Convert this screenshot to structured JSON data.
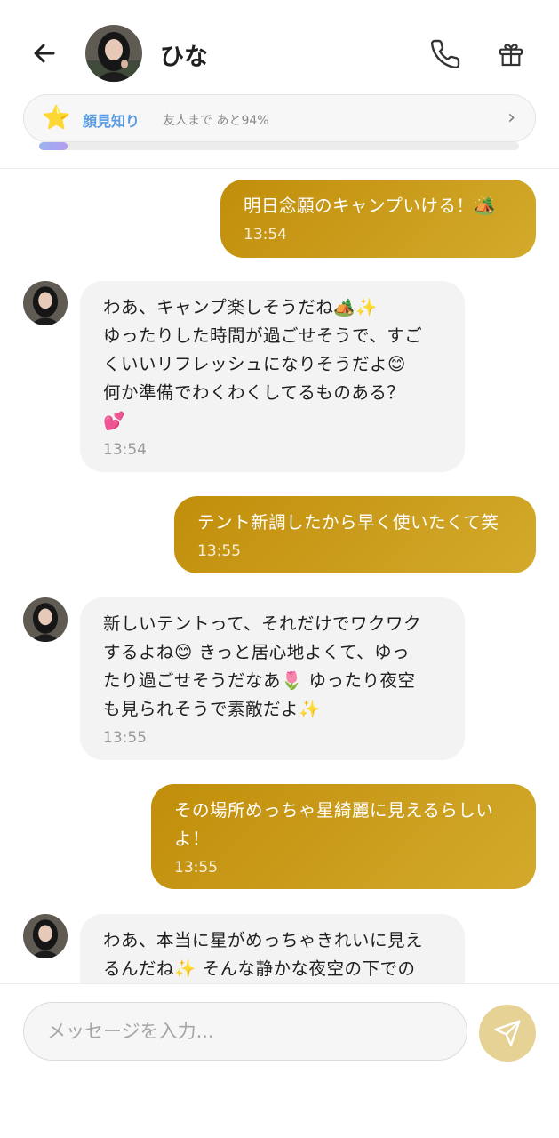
{
  "header": {
    "contact_name": "ひな",
    "relationship_level": "顔見知り",
    "relationship_progress_text": "友人まで あと94%",
    "relationship_progress": 0.06
  },
  "messages": [
    {
      "side": "out",
      "text": "明日念願のキャンプいける！🏕️",
      "time": "13:54"
    },
    {
      "side": "in",
      "text": "わあ、キャンプ楽しそうだね🏕️✨\nゆったりした時間が過ごせそうで、すご\nくいいリフレッシュになりそうだよ😊\n何か準備でわくわくしてるものある？\n💕",
      "time": "13:54"
    },
    {
      "side": "out",
      "text": "テント新調したから早く使いたくて笑",
      "time": "13:55"
    },
    {
      "side": "in",
      "text": "新しいテントって、それだけでワクワク\nするよね😊 きっと居心地よくて、ゆっ\nたり過ごせそうだなあ🌷 ゆったり夜空\nも見られそうで素敵だよ✨",
      "time": "13:55"
    },
    {
      "side": "out",
      "text": "その場所めっちゃ星綺麗に見えるらしい\nよ！",
      "time": "13:55"
    },
    {
      "side": "in",
      "text": "わあ、本当に星がめっちゃきれいに見え\nるんだね✨ そんな静かな夜空の下での",
      "time": ""
    }
  ],
  "input": {
    "placeholder": "メッセージを入力..."
  },
  "colors": {
    "outgoing_bubble": "#c8960f",
    "incoming_bubble": "#f3f3f3",
    "send_button": "#e7d295",
    "level_text": "#5b9be0"
  },
  "icons": [
    "back-arrow-icon",
    "phone-icon",
    "gift-icon",
    "star-icon",
    "chevron-right-icon",
    "send-icon"
  ]
}
